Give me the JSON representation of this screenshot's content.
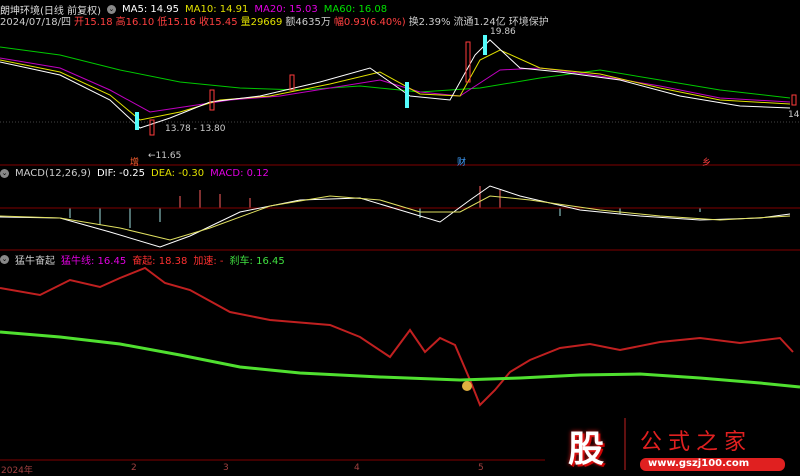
{
  "header": {
    "title": "朗坤环境(日线 前复权)",
    "ma5": "MA5: 14.95",
    "ma10": "MA10: 14.91",
    "ma20": "MA20: 15.03",
    "ma60": "MA60: 16.08"
  },
  "quote": {
    "date": "2024/07/18/四",
    "open": "开15.18",
    "high": "高16.10",
    "low": "低15.16",
    "close": "收15.45",
    "vol": "量29669",
    "amount": "额4635万",
    "change": "幅0.93(6.40%)",
    "turnover": "换2.39%",
    "float": "流通1.24亿",
    "sector": "环境保护"
  },
  "annotations": {
    "high": "19.86",
    "mid": "13.78 - 13.80",
    "low": "←11.65",
    "right": "14",
    "mark1": "增",
    "mark2": "财",
    "mark3": "乡"
  },
  "macd": {
    "title": "MACD(12,26,9)",
    "dif": "DIF: -0.25",
    "dea": "DEA: -0.30",
    "macd": "MACD: 0.12"
  },
  "indicator": {
    "title": "猛牛奋起",
    "line1": "猛牛线: 16.45",
    "line2": "奋起: 18.38",
    "line3": "加速: -",
    "line4": "刹车: 16.45"
  },
  "xaxis": [
    "2024年",
    "2",
    "3",
    "4",
    "5"
  ],
  "logo": {
    "char": "股",
    "name": "公式之家",
    "url": "www.gszj100.com"
  },
  "colors": {
    "up": "#ff3c3c",
    "down": "#54fcfc",
    "ma5": "#ffffff",
    "ma10": "#ffff00",
    "ma20": "#ff00ff",
    "ma60": "#00e600"
  }
}
